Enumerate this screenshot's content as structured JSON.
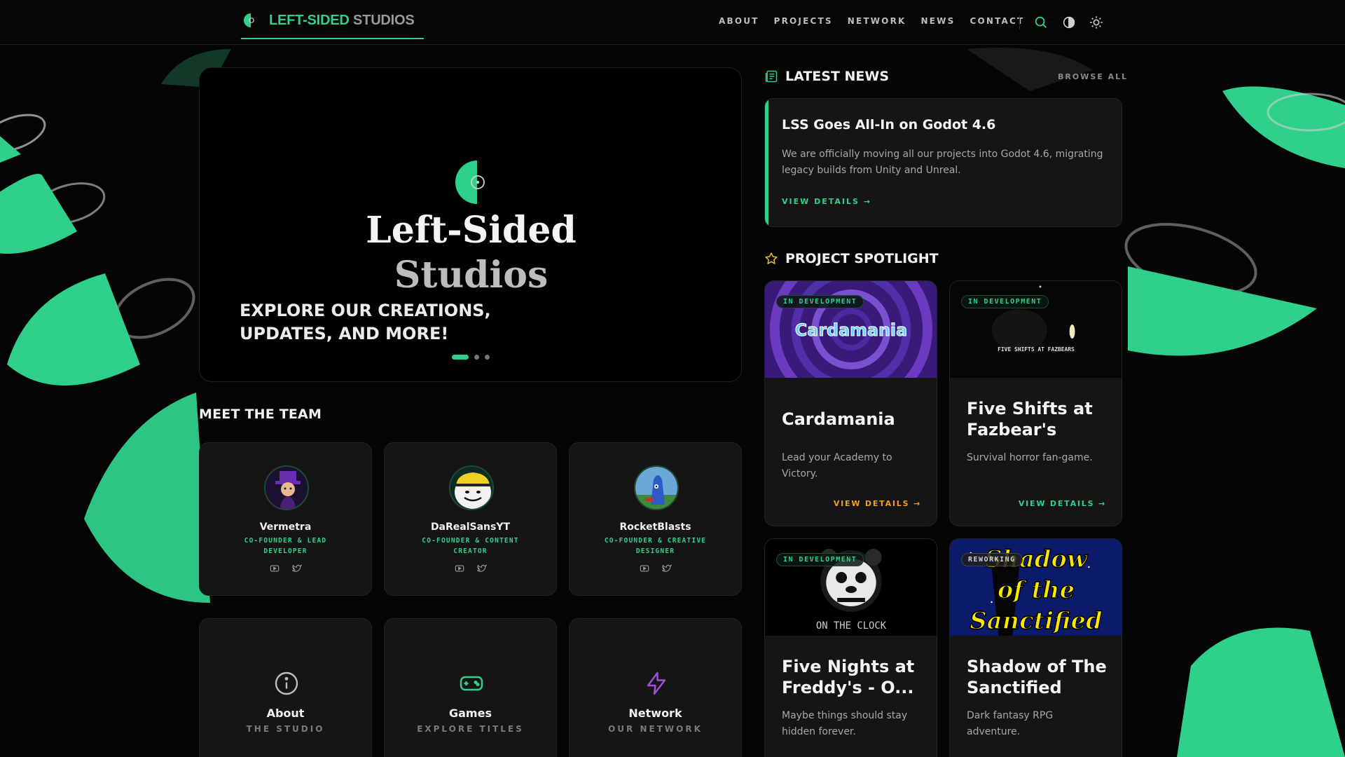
{
  "nav": {
    "brand_primary": "LEFT-SIDED",
    "brand_secondary": "STUDIOS",
    "links": [
      "ABOUT",
      "PROJECTS",
      "NETWORK",
      "NEWS",
      "CONTACT"
    ],
    "icons": [
      "search-icon",
      "contrast-icon",
      "sun-icon"
    ]
  },
  "hero": {
    "title_line1": "Left-Sided",
    "title_line2": "Studios",
    "subtitle": "EXPLORE OUR CREATIONS, UPDATES, AND MORE!",
    "slide_count": 3,
    "active_slide": 1
  },
  "team": {
    "heading": "MEET THE TEAM",
    "members": [
      {
        "name": "Vermetra",
        "role": "CO-FOUNDER & LEAD DEVELOPER"
      },
      {
        "name": "DaRealSansYT",
        "role": "CO-FOUNDER & CONTENT CREATOR"
      },
      {
        "name": "RocketBlasts",
        "role": "CO-FOUNDER & CREATIVE DESIGNER"
      }
    ]
  },
  "quick_links": [
    {
      "title": "About",
      "subtitle": "THE STUDIO",
      "icon": "info-icon"
    },
    {
      "title": "Games",
      "subtitle": "EXPLORE TITLES",
      "icon": "gamepad-icon"
    },
    {
      "title": "Network",
      "subtitle": "OUR NETWORK",
      "icon": "lightning-icon"
    }
  ],
  "news": {
    "heading": "LATEST NEWS",
    "browse_all": "BROWSE ALL",
    "item": {
      "title": "LSS Goes All-In on Godot 4.6",
      "body": "We are officially moving all our projects into Godot 4.6, migrating legacy builds from Unity and Unreal.",
      "link": "VIEW DETAILS →"
    }
  },
  "spotlight": {
    "heading": "PROJECT SPOTLIGHT",
    "projects": [
      {
        "badge": "IN DEVELOPMENT",
        "title": "Cardamania",
        "description": "Lead your Academy to Victory.",
        "link": "VIEW DETAILS →",
        "thumb_text": "Cardamania",
        "link_color": "#f0a020"
      },
      {
        "badge": "IN DEVELOPMENT",
        "title": "Five Shifts at Fazbear's",
        "description": "Survival horror fan-game.",
        "link": "VIEW DETAILS →",
        "thumb_text": "FIVE SHIFTS AT FAZBEARS",
        "link_color": "#2fd08a"
      },
      {
        "badge": "IN DEVELOPMENT",
        "title": "Five Nights at Freddy's - O...",
        "description": "Maybe things should stay hidden forever.",
        "thumb_text": "ON THE CLOCK"
      },
      {
        "badge": "REWORKING",
        "title": "Shadow of The Sanctified",
        "description": "Dark fantasy RPG adventure.",
        "thumb_text": "Shadow of the Sanctified"
      }
    ]
  },
  "colors": {
    "accent": "#2fd08a",
    "orange_link": "#f0a020",
    "background": "#050505",
    "card": "#151515"
  }
}
